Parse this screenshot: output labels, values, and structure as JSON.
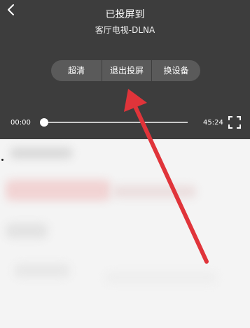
{
  "header": {
    "title": "已投屏到",
    "device": "客厅电视-DLNA"
  },
  "controls": {
    "quality_label": "超清",
    "exit_label": "退出投屏",
    "switch_label": "换设备"
  },
  "player": {
    "current_time": "00:00",
    "total_time": "45:24",
    "progress": 0
  },
  "icons": {
    "back": "chevron-left-icon",
    "fullscreen": "fullscreen-icon"
  },
  "colors": {
    "panel": "#3d3d3d",
    "annotation_arrow": "#e0343a"
  }
}
